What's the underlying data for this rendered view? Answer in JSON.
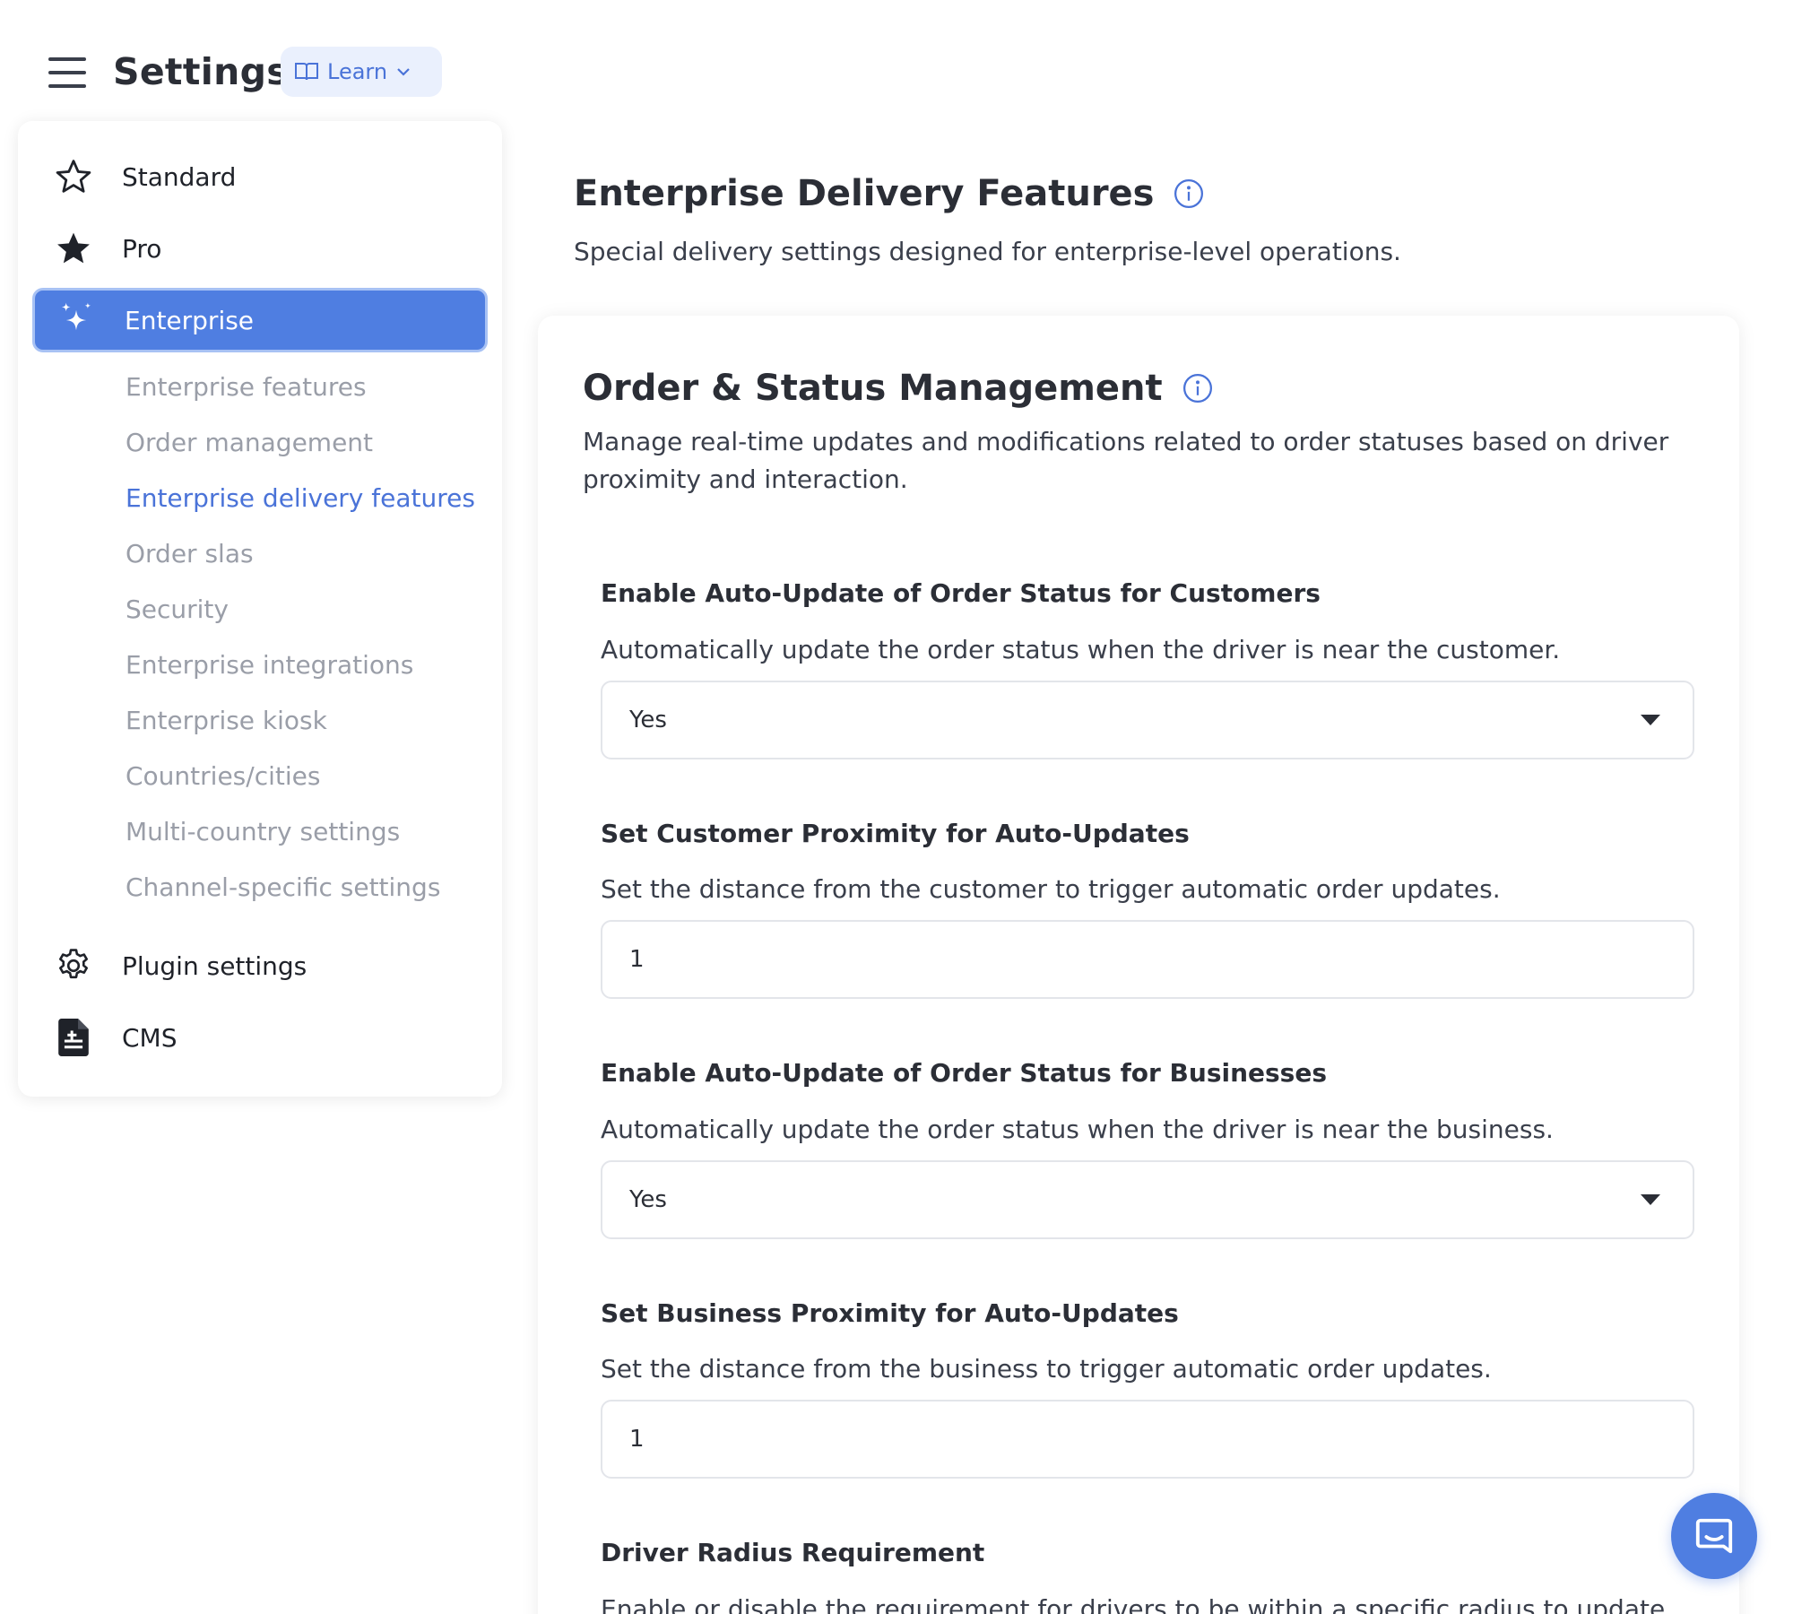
{
  "header": {
    "title": "Settings",
    "learn_label": "Learn"
  },
  "sidebar": {
    "items": [
      {
        "label": "Standard",
        "icon": "star-outline-icon"
      },
      {
        "label": "Pro",
        "icon": "star-filled-icon"
      },
      {
        "label": "Enterprise",
        "icon": "sparkles-icon",
        "active": true
      }
    ],
    "sub_items": [
      "Enterprise features",
      "Order management",
      "Enterprise delivery features",
      "Order slas",
      "Security",
      "Enterprise integrations",
      "Enterprise kiosk",
      "Countries/cities",
      "Multi-country settings",
      "Channel-specific settings"
    ],
    "current_sub_item": "Enterprise delivery features",
    "bottom_items": [
      {
        "label": "Plugin settings",
        "icon": "gear-icon"
      },
      {
        "label": "CMS",
        "icon": "document-icon"
      }
    ]
  },
  "main": {
    "title": "Enterprise Delivery Features",
    "description": "Special delivery settings designed for enterprise-level operations.",
    "card": {
      "title": "Order & Status Management",
      "description": "Manage real-time updates and modifications related to order statuses based on driver proximity and interaction.",
      "fields": [
        {
          "label": "Enable Auto-Update of Order Status for Customers",
          "help": "Automatically update the order status when the driver is near the customer.",
          "type": "select",
          "value": "Yes"
        },
        {
          "label": "Set Customer Proximity for Auto-Updates",
          "help": "Set the distance from the customer to trigger automatic order updates.",
          "type": "input",
          "value": "1"
        },
        {
          "label": "Enable Auto-Update of Order Status for Businesses",
          "help": "Automatically update the order status when the driver is near the business.",
          "type": "select",
          "value": "Yes"
        },
        {
          "label": "Set Business Proximity for Auto-Updates",
          "help": "Set the distance from the business to trigger automatic order updates.",
          "type": "input",
          "value": "1"
        },
        {
          "label": "Driver Radius Requirement",
          "help": "Enable or disable the requirement for drivers to be within a specific radius to update"
        }
      ]
    }
  },
  "colors": {
    "accent": "#4f7ee1",
    "accent_text": "#4a73d8",
    "muted_text": "#9a9ea8",
    "learn_bg": "#eaf0fd"
  }
}
